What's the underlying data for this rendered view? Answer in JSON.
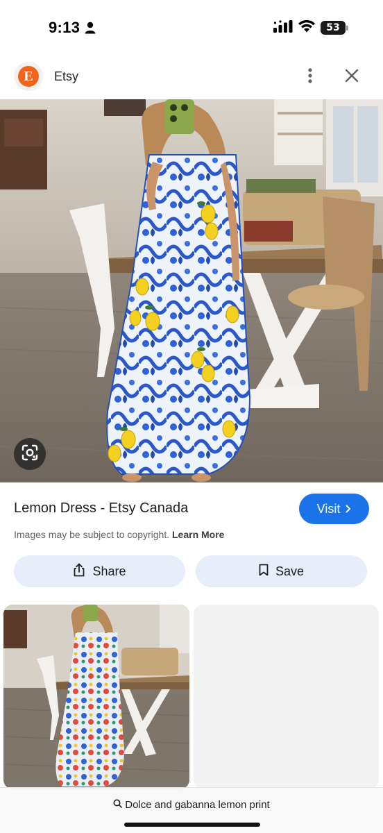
{
  "status_bar": {
    "time": "9:13",
    "battery": "53"
  },
  "site": {
    "logo_letter": "E",
    "name": "Etsy",
    "brand_color": "#f1641e"
  },
  "result": {
    "title": "Lemon Dress - Etsy Canada",
    "visit_label": "Visit",
    "copyright_text": "Images may be subject to copyright.",
    "learn_more_label": "Learn More"
  },
  "actions": {
    "share_label": "Share",
    "save_label": "Save"
  },
  "bottom_search": {
    "query": "Dolce and gabanna lemon print"
  },
  "colors": {
    "accent": "#1a73e8",
    "pill_background": "#e8eef9"
  },
  "icons": [
    "person-icon",
    "signal-icon",
    "wifi-icon",
    "battery-icon",
    "more-vert-icon",
    "close-icon",
    "lens-icon",
    "chevron-right-icon",
    "share-icon",
    "bookmark-icon",
    "search-icon"
  ]
}
